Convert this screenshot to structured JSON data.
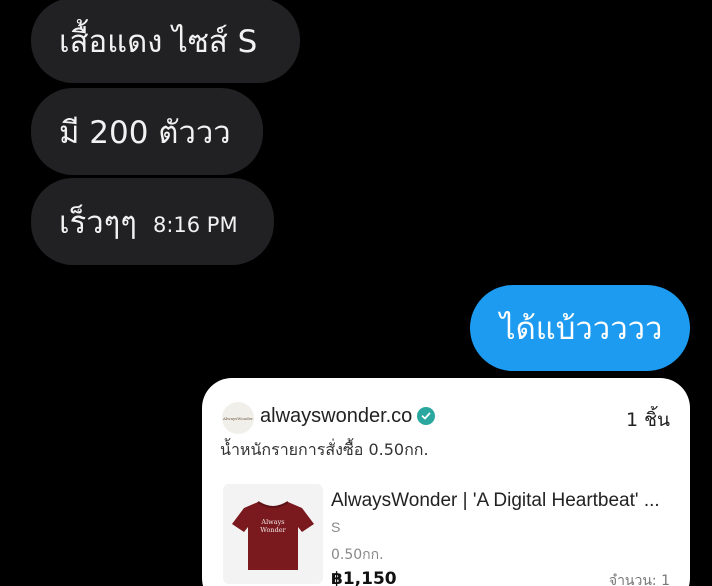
{
  "messages": {
    "incoming": [
      {
        "text": "เสื้อแดง ไซส์ S"
      },
      {
        "text": "มี 200 ตัววว"
      },
      {
        "text": "เร็วๆๆ",
        "time": "8:16 PM"
      }
    ],
    "outgoing": [
      {
        "text": "ได้แบ้ววววว"
      }
    ]
  },
  "order_card": {
    "shop_logo_text": "AlwaysWonder",
    "shop_name": "alwayswonder.co",
    "verified_icon": "verified-badge-icon",
    "item_count": "1 ชิ้น",
    "order_weight": "น้ำหนักรายการสั่งซื้อ 0.50กก.",
    "product": {
      "title": "AlwaysWonder | 'A Digital Heartbeat' ...",
      "variant": "S",
      "weight": "0.50กก.",
      "price": "฿1,150",
      "quantity": "จำนวน: 1",
      "shirt_color": "#7a1a1e",
      "shirt_print": "Always Wonder"
    }
  },
  "colors": {
    "background": "#000000",
    "incoming_bubble": "#212123",
    "outgoing_bubble": "#1d9bf0",
    "card": "#ffffff",
    "verified": "#2aa8a0"
  }
}
